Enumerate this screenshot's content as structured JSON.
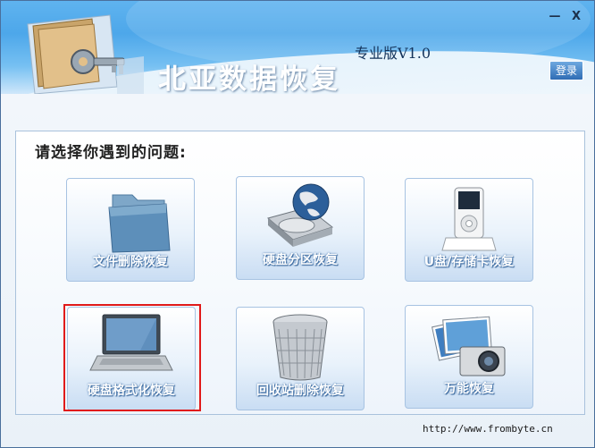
{
  "window": {
    "title": "北亚数据恢复",
    "edition": "专业版V1.0",
    "minimize_label": "—",
    "close_label": "X",
    "login_label": "登录"
  },
  "prompt": "请选择你遇到的问题:",
  "tiles": [
    {
      "label": "文件删除恢复",
      "icon": "folder-icon"
    },
    {
      "label": "硬盘分区恢复",
      "icon": "hard-disk-globe-icon"
    },
    {
      "label": "U盘/存储卡恢复",
      "icon": "usb-player-icon"
    },
    {
      "label": "硬盘格式化恢复",
      "icon": "laptop-icon",
      "selected": true
    },
    {
      "label": "回收站删除恢复",
      "icon": "recycle-bin-icon"
    },
    {
      "label": "万能恢复",
      "icon": "camera-photos-icon"
    }
  ],
  "footer": {
    "url": "http://www.frombyte.cn"
  },
  "colors": {
    "header": "#4da7ea",
    "selection": "#e01a1a",
    "tile_border": "#a7c3e2"
  }
}
